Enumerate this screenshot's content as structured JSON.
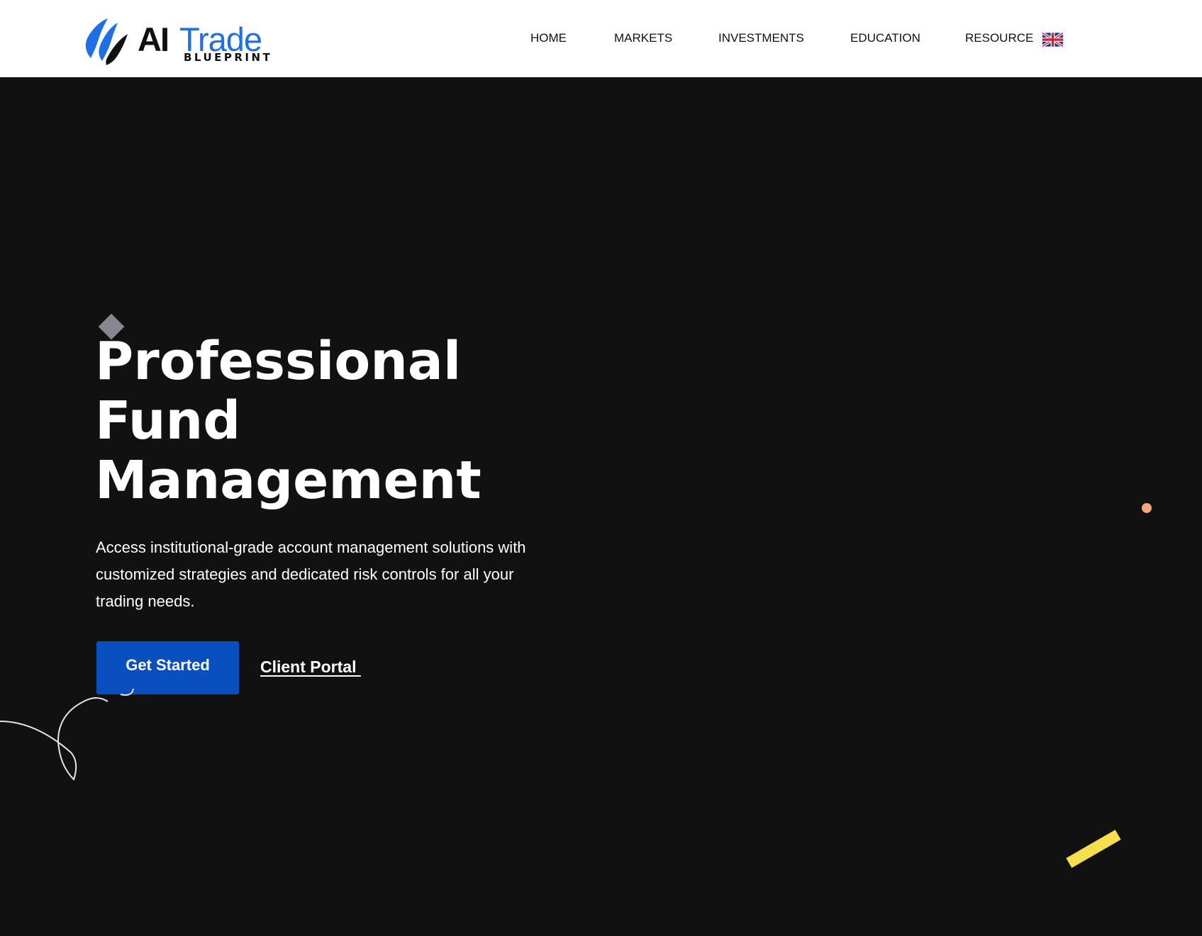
{
  "brand": {
    "name_bold": "AI",
    "name_light": "Trade",
    "tagline": "BLUEPRINT",
    "accent": "#1f6fe5"
  },
  "nav": {
    "items": [
      {
        "label": "HOME"
      },
      {
        "label": "MARKETS"
      },
      {
        "label": "INVESTMENTS"
      },
      {
        "label": "EDUCATION"
      },
      {
        "label": "RESOURCE"
      }
    ],
    "language_icon": "uk-flag-icon"
  },
  "hero": {
    "title_lines": [
      "Professional",
      "Fund",
      "Management"
    ],
    "description": "Access institutional-grade account management solutions with customized strategies and dedicated risk controls for all your trading needs.",
    "primary_cta": "Get Started",
    "secondary_cta": "Client Portal ",
    "background": "#111111",
    "button_color": "#0a4fbf"
  },
  "decorations": {
    "diamond_color": "#8a8590",
    "dot_color": "#f5a77a",
    "bar_color": "#f4e04d",
    "curve_color": "#e6e6e6"
  }
}
